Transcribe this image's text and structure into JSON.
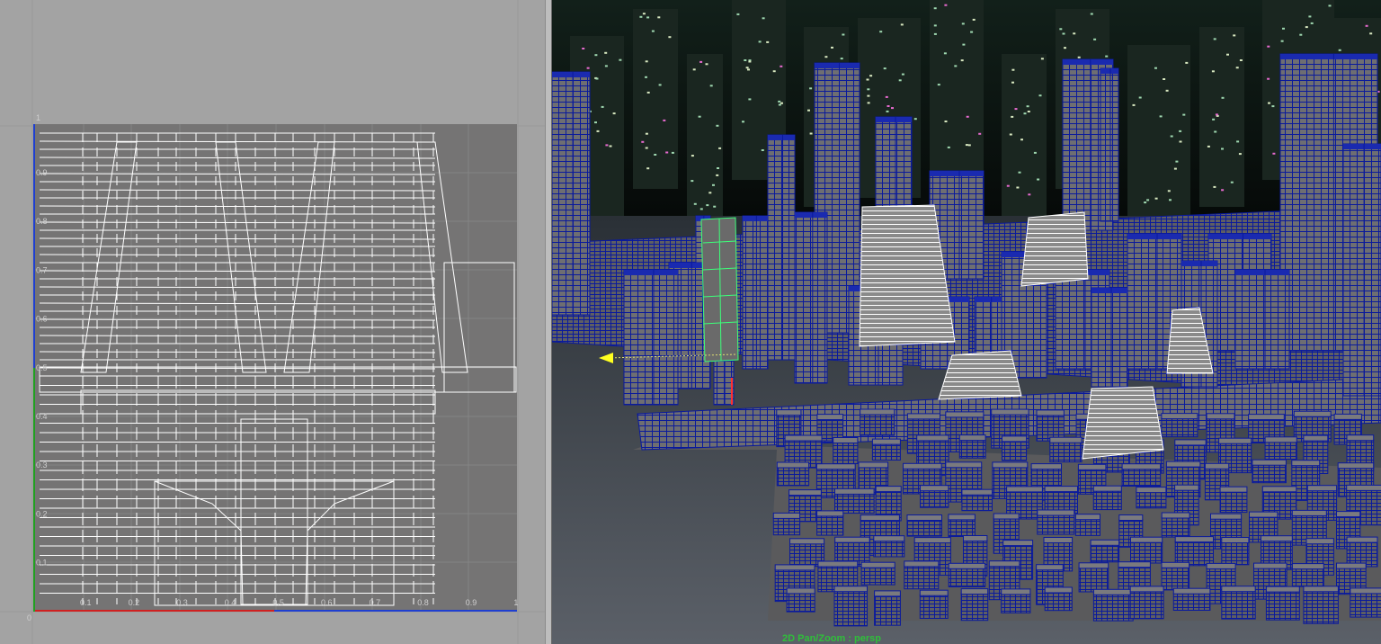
{
  "uv_editor": {
    "ticks_x": [
      "0.1",
      "0.2",
      "0.3",
      "0.4",
      "0.5",
      "0.6",
      "0.7",
      "0.8",
      "0.9",
      "1"
    ],
    "ticks_y": [
      "0.9",
      "0.8",
      "0.7",
      "0.6",
      "0.5",
      "0.4",
      "0.3",
      "0.2",
      "0.1",
      "1"
    ],
    "origin_label": "0"
  },
  "viewport": {
    "hud_label": "2D Pan/Zoom : persp"
  },
  "colors": {
    "wire": "#0a1a9c",
    "selection": "#3dff7a",
    "uv_lines": "#ffffff",
    "axis_u": "#d02020",
    "axis_v": "#20a020"
  }
}
